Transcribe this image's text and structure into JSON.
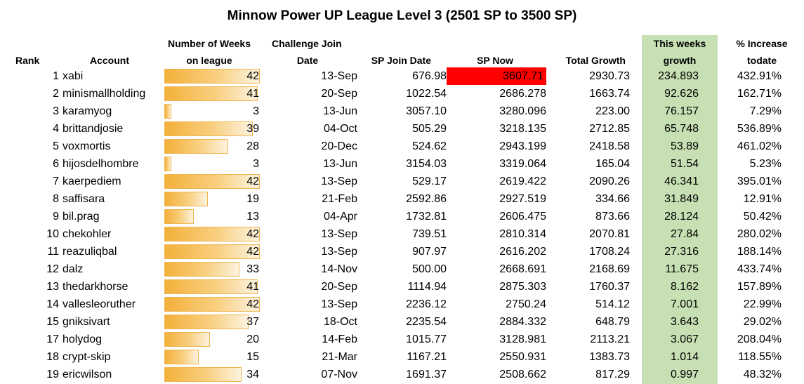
{
  "title": "Minnow Power UP League Level 3 (2501 SP to 3500 SP)",
  "headers": {
    "rank": "Rank",
    "account": "Account",
    "weeks_line1": "Number of Weeks",
    "weeks_line2": "on league",
    "join_line1": "Challenge Join",
    "join_line2": "Date",
    "sp_join": "SP Join Date",
    "sp_now": "SP Now",
    "total_growth": "Total Growth",
    "week_growth_line1": "This weeks",
    "week_growth_line2": "growth",
    "increase_line1": "% Increase",
    "increase_line2": "todate"
  },
  "colors": {
    "highlight": "#ff0000",
    "growth_column": "#c6e0b4",
    "bar": "#f4b03a"
  },
  "max_weeks": 42,
  "rows": [
    {
      "rank": "1",
      "account": "xabi",
      "weeks": 42,
      "join_date": "13-Sep",
      "sp_join": "676.98",
      "sp_now": "3607.71",
      "total_growth": "2930.73",
      "week_growth": "234.893",
      "increase": "432.91%",
      "highlight": true
    },
    {
      "rank": "2",
      "account": "minismallholding",
      "weeks": 41,
      "join_date": "20-Sep",
      "sp_join": "1022.54",
      "sp_now": "2686.278",
      "total_growth": "1663.74",
      "week_growth": "92.626",
      "increase": "162.71%"
    },
    {
      "rank": "3",
      "account": "karamyog",
      "weeks": 3,
      "join_date": "13-Jun",
      "sp_join": "3057.10",
      "sp_now": "3280.096",
      "total_growth": "223.00",
      "week_growth": "76.157",
      "increase": "7.29%"
    },
    {
      "rank": "4",
      "account": "brittandjosie",
      "weeks": 39,
      "join_date": "04-Oct",
      "sp_join": "505.29",
      "sp_now": "3218.135",
      "total_growth": "2712.85",
      "week_growth": "65.748",
      "increase": "536.89%"
    },
    {
      "rank": "5",
      "account": "voxmortis",
      "weeks": 28,
      "join_date": "20-Dec",
      "sp_join": "524.62",
      "sp_now": "2943.199",
      "total_growth": "2418.58",
      "week_growth": "53.89",
      "increase": "461.02%"
    },
    {
      "rank": "6",
      "account": "hijosdelhombre",
      "weeks": 3,
      "join_date": "13-Jun",
      "sp_join": "3154.03",
      "sp_now": "3319.064",
      "total_growth": "165.04",
      "week_growth": "51.54",
      "increase": "5.23%"
    },
    {
      "rank": "7",
      "account": "kaerpediem",
      "weeks": 42,
      "join_date": "13-Sep",
      "sp_join": "529.17",
      "sp_now": "2619.422",
      "total_growth": "2090.26",
      "week_growth": "46.341",
      "increase": "395.01%"
    },
    {
      "rank": "8",
      "account": "saffisara",
      "weeks": 19,
      "join_date": "21-Feb",
      "sp_join": "2592.86",
      "sp_now": "2927.519",
      "total_growth": "334.66",
      "week_growth": "31.849",
      "increase": "12.91%"
    },
    {
      "rank": "9",
      "account": "bil.prag",
      "weeks": 13,
      "join_date": "04-Apr",
      "sp_join": "1732.81",
      "sp_now": "2606.475",
      "total_growth": "873.66",
      "week_growth": "28.124",
      "increase": "50.42%"
    },
    {
      "rank": "10",
      "account": "chekohler",
      "weeks": 42,
      "join_date": "13-Sep",
      "sp_join": "739.51",
      "sp_now": "2810.314",
      "total_growth": "2070.81",
      "week_growth": "27.84",
      "increase": "280.02%"
    },
    {
      "rank": "11",
      "account": "reazuliqbal",
      "weeks": 42,
      "join_date": "13-Sep",
      "sp_join": "907.97",
      "sp_now": "2616.202",
      "total_growth": "1708.24",
      "week_growth": "27.316",
      "increase": "188.14%"
    },
    {
      "rank": "12",
      "account": "dalz",
      "weeks": 33,
      "join_date": "14-Nov",
      "sp_join": "500.00",
      "sp_now": "2668.691",
      "total_growth": "2168.69",
      "week_growth": "11.675",
      "increase": "433.74%"
    },
    {
      "rank": "13",
      "account": "thedarkhorse",
      "weeks": 41,
      "join_date": "20-Sep",
      "sp_join": "1114.94",
      "sp_now": "2875.303",
      "total_growth": "1760.37",
      "week_growth": "8.162",
      "increase": "157.89%"
    },
    {
      "rank": "14",
      "account": "vallesleoruther",
      "weeks": 42,
      "join_date": "13-Sep",
      "sp_join": "2236.12",
      "sp_now": "2750.24",
      "total_growth": "514.12",
      "week_growth": "7.001",
      "increase": "22.99%"
    },
    {
      "rank": "15",
      "account": "gniksivart",
      "weeks": 37,
      "join_date": "18-Oct",
      "sp_join": "2235.54",
      "sp_now": "2884.332",
      "total_growth": "648.79",
      "week_growth": "3.643",
      "increase": "29.02%"
    },
    {
      "rank": "17",
      "account": "holydog",
      "weeks": 20,
      "join_date": "14-Feb",
      "sp_join": "1015.77",
      "sp_now": "3128.981",
      "total_growth": "2113.21",
      "week_growth": "3.067",
      "increase": "208.04%"
    },
    {
      "rank": "18",
      "account": "crypt-skip",
      "weeks": 15,
      "join_date": "21-Mar",
      "sp_join": "1167.21",
      "sp_now": "2550.931",
      "total_growth": "1383.73",
      "week_growth": "1.014",
      "increase": "118.55%"
    },
    {
      "rank": "19",
      "account": "ericwilson",
      "weeks": 34,
      "join_date": "07-Nov",
      "sp_join": "1691.37",
      "sp_now": "2508.662",
      "total_growth": "817.29",
      "week_growth": "0.997",
      "increase": "48.32%"
    }
  ]
}
